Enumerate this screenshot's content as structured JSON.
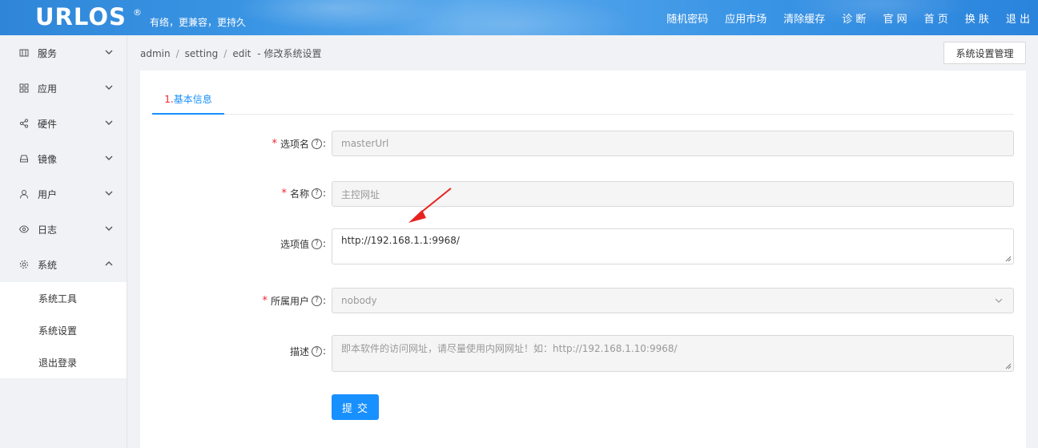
{
  "header": {
    "logo": "URLOS",
    "logo_mark": "®",
    "slogan": "有络，更兼容，更持久",
    "nav": [
      "随机密码",
      "应用市场",
      "清除缓存",
      "诊 断",
      "官 网",
      "首 页",
      "换 肤",
      "退 出"
    ]
  },
  "sidebar": {
    "items": [
      {
        "label": "服务",
        "icon": "server-icon"
      },
      {
        "label": "应用",
        "icon": "grid-icon"
      },
      {
        "label": "硬件",
        "icon": "share-icon"
      },
      {
        "label": "镜像",
        "icon": "drive-icon"
      },
      {
        "label": "用户",
        "icon": "user-icon"
      },
      {
        "label": "日志",
        "icon": "eye-icon"
      },
      {
        "label": "系统",
        "icon": "gear-icon"
      }
    ],
    "submenu": [
      "系统工具",
      "系统设置",
      "退出登录"
    ]
  },
  "breadcrumb": {
    "parts": [
      "admin",
      "setting",
      "edit"
    ],
    "dash": "-",
    "title": "修改系统设置"
  },
  "actions": {
    "manage_label": "系统设置管理"
  },
  "tabs": {
    "num": "1.",
    "label": "基本信息"
  },
  "form": {
    "option_name": {
      "label": "选项名",
      "value": "masterUrl",
      "required": "*"
    },
    "name": {
      "label": "名称",
      "value": "主控网址",
      "required": "*"
    },
    "option_value": {
      "label": "选项值",
      "value": "http://192.168.1.1:9968/"
    },
    "owner": {
      "label": "所属用户",
      "value": "nobody",
      "required": "*"
    },
    "description": {
      "label": "描述",
      "value": "即本软件的访问网址，请尽量使用内网网址！如：http://192.168.1.10:9968/"
    },
    "help_glyph": "?",
    "colon": ":",
    "submit_label": "提 交"
  },
  "colors": {
    "accent": "#1890ff",
    "required": "#f5222d",
    "annotation_arrow": "#e8231f"
  }
}
